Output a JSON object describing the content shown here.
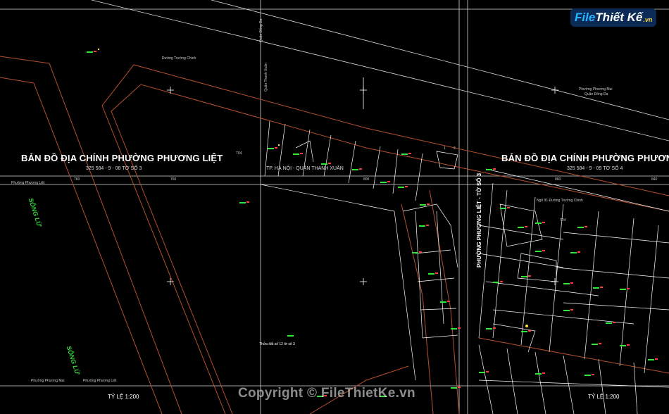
{
  "map": {
    "title_left": "BẢN ĐỒ ĐỊA CHÍNH PHƯỜNG PHƯƠNG LIỆT",
    "sheet_left": "325 584 - 9 - 08 TỜ SỐ 3",
    "title_right": "BẢN ĐỒ ĐỊA CHÍNH PHƯỜNG PHƯƠN",
    "sheet_right": "325 584 - 9 - 09 TỜ SỐ 4",
    "city_label": "TP. HÀ NỘI - QUẬN THANH XUÂN",
    "river_label_1": "SÔNG LỪ",
    "river_label_2": "SÔNG LỪ",
    "ward_label_vertical": "PHƯỜNG PHƯƠNG LIỆT - TỜ SỐ 3",
    "ward_mai": "Phường Phương Mai",
    "district_dongda": "Quận Đống Đa",
    "road_truong_chinh": "Đường Trường Chinh",
    "road_nguyen_thu": "Ngõ 91 Đường Trường Chinh",
    "district_thanhxuan": "Quận Thanh Xuân",
    "district_dongda_v": "Quận Đống Đa",
    "grid_760": "760",
    "grid_800": "800",
    "grid_860": "860",
    "grid_840": "840",
    "t04_a": "T04",
    "t04_b": "T04",
    "ward_pl_bottom": "Phường Phương Mai",
    "ward_pl_left": "Phường Phương Liệt",
    "ward_pl_left2": "Phường Phương Liệt",
    "scale_left": "TỶ LỆ 1:200",
    "scale_right": "TỶ LỆ 1:200",
    "note": "Thửa đất số 12 tờ số 3",
    "nums": [
      "1",
      "2"
    ],
    "watermark": "Copyright © FileThietKe.vn",
    "logo_a": "File",
    "logo_b": "Thiết Kế",
    "logo_c": ".vn"
  },
  "colors": {
    "boundary": "#b5502f",
    "grid": "#ffffff",
    "parcel": "#ffffff",
    "label_green": "#2ee83a",
    "label_red": "#ff3b3b",
    "label_yellow": "#ffe23a"
  }
}
